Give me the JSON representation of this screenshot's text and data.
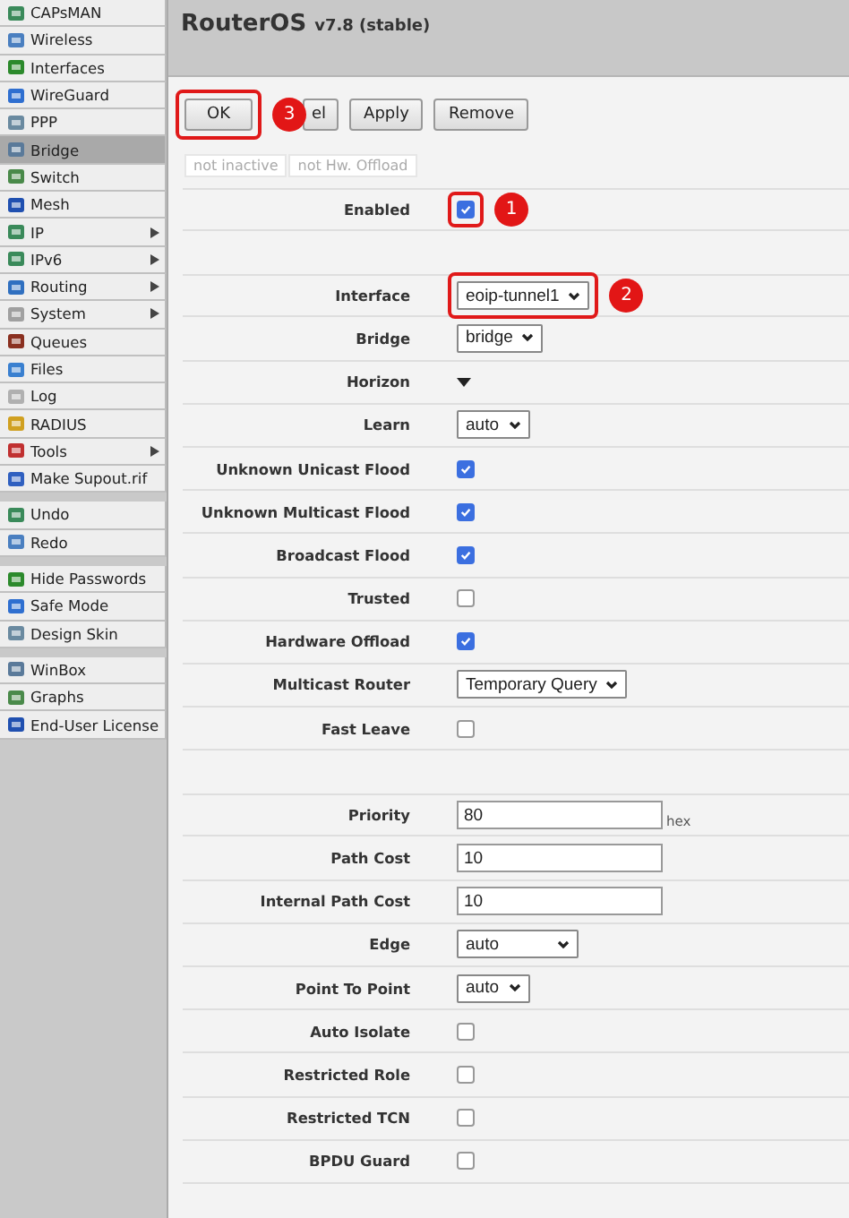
{
  "sidebar": {
    "groups": [
      {
        "items": [
          {
            "label": "CAPsMAN",
            "submenu": false,
            "selected": false
          },
          {
            "label": "Wireless",
            "submenu": false,
            "selected": false
          },
          {
            "label": "Interfaces",
            "submenu": false,
            "selected": false
          },
          {
            "label": "WireGuard",
            "submenu": false,
            "selected": false
          },
          {
            "label": "PPP",
            "submenu": false,
            "selected": false
          },
          {
            "label": "Bridge",
            "submenu": false,
            "selected": true
          },
          {
            "label": "Switch",
            "submenu": false,
            "selected": false
          },
          {
            "label": "Mesh",
            "submenu": false,
            "selected": false
          },
          {
            "label": "IP",
            "submenu": true,
            "selected": false
          },
          {
            "label": "IPv6",
            "submenu": true,
            "selected": false
          },
          {
            "label": "Routing",
            "submenu": true,
            "selected": false
          },
          {
            "label": "System",
            "submenu": true,
            "selected": false
          },
          {
            "label": "Queues",
            "submenu": false,
            "selected": false
          },
          {
            "label": "Files",
            "submenu": false,
            "selected": false
          },
          {
            "label": "Log",
            "submenu": false,
            "selected": false
          },
          {
            "label": "RADIUS",
            "submenu": false,
            "selected": false
          },
          {
            "label": "Tools",
            "submenu": true,
            "selected": false
          },
          {
            "label": "Make Supout.rif",
            "submenu": false,
            "selected": false
          }
        ]
      },
      {
        "items": [
          {
            "label": "Undo",
            "submenu": false,
            "selected": false
          },
          {
            "label": "Redo",
            "submenu": false,
            "selected": false
          }
        ]
      },
      {
        "items": [
          {
            "label": "Hide Passwords",
            "submenu": false,
            "selected": false
          },
          {
            "label": "Safe Mode",
            "submenu": false,
            "selected": false
          },
          {
            "label": "Design Skin",
            "submenu": false,
            "selected": false
          }
        ]
      },
      {
        "items": [
          {
            "label": "WinBox",
            "submenu": false,
            "selected": false
          },
          {
            "label": "Graphs",
            "submenu": false,
            "selected": false
          },
          {
            "label": "End-User License",
            "submenu": false,
            "selected": false
          }
        ]
      }
    ]
  },
  "header": {
    "title": "RouterOS",
    "version": "v7.8 (stable)"
  },
  "buttons": [
    {
      "label": "OK",
      "callout": "3"
    },
    {
      "label": "el"
    },
    {
      "label": "Apply"
    },
    {
      "label": "Remove"
    }
  ],
  "filters": [
    "not inactive",
    "not Hw. Offload"
  ],
  "sections": [
    {
      "rows": [
        {
          "label": "Enabled",
          "kind": "checkbox",
          "checked": true,
          "callout": "1"
        }
      ]
    },
    {
      "rows": [
        {
          "label": "Interface",
          "kind": "select",
          "value": "eoip-tunnel1",
          "callout": "2"
        },
        {
          "label": "Bridge",
          "kind": "select",
          "value": "bridge"
        },
        {
          "label": "Horizon",
          "kind": "expander"
        },
        {
          "label": "Learn",
          "kind": "select",
          "value": "auto"
        },
        {
          "label": "Unknown Unicast Flood",
          "kind": "checkbox",
          "checked": true
        },
        {
          "label": "Unknown Multicast Flood",
          "kind": "checkbox",
          "checked": true
        },
        {
          "label": "Broadcast Flood",
          "kind": "checkbox",
          "checked": true
        },
        {
          "label": "Trusted",
          "kind": "checkbox",
          "checked": false
        },
        {
          "label": "Hardware Offload",
          "kind": "checkbox",
          "checked": true
        },
        {
          "label": "Multicast Router",
          "kind": "select",
          "value": "Temporary Query"
        },
        {
          "label": "Fast Leave",
          "kind": "checkbox",
          "checked": false
        }
      ]
    },
    {
      "rows": [
        {
          "label": "Priority",
          "kind": "text",
          "value": "80",
          "unit": "hex"
        },
        {
          "label": "Path Cost",
          "kind": "text",
          "value": "10"
        },
        {
          "label": "Internal Path Cost",
          "kind": "text",
          "value": "10"
        },
        {
          "label": "Edge",
          "kind": "select",
          "value": "auto",
          "wide": true
        },
        {
          "label": "Point To Point",
          "kind": "select",
          "value": "auto"
        },
        {
          "label": "Auto Isolate",
          "kind": "checkbox",
          "checked": false
        },
        {
          "label": "Restricted Role",
          "kind": "checkbox",
          "checked": false
        },
        {
          "label": "Restricted TCN",
          "kind": "checkbox",
          "checked": false
        },
        {
          "label": "BPDU Guard",
          "kind": "checkbox",
          "checked": false
        }
      ]
    }
  ]
}
